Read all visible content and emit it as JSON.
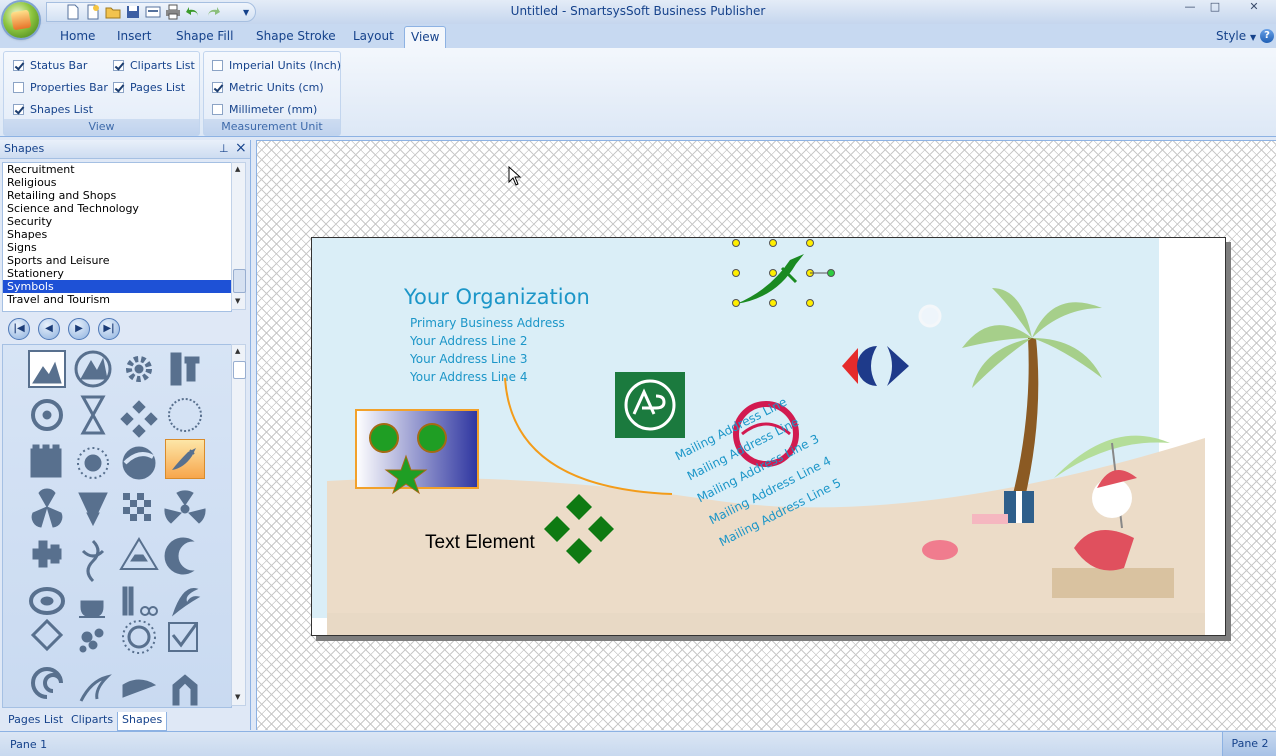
{
  "window": {
    "title": "Untitled - SmartsysSoft Business Publisher",
    "minimize_label": "—",
    "maximize_label": "□",
    "close_label": "✕"
  },
  "ribbon": {
    "tabs": [
      "Home",
      "Insert",
      "Shape Fill",
      "Shape Stroke",
      "Layout",
      "View"
    ],
    "active_tab": "View",
    "style_label": "Style",
    "help_label": "?",
    "view_group": {
      "caption": "View",
      "checks": [
        {
          "label": "Status Bar",
          "checked": true
        },
        {
          "label": "Properties Bar",
          "checked": false
        },
        {
          "label": "Shapes List",
          "checked": true
        },
        {
          "label": "Cliparts List",
          "checked": true
        },
        {
          "label": "Pages List",
          "checked": true
        }
      ]
    },
    "measure_group": {
      "caption": "Measurement Unit",
      "checks": [
        {
          "label": "Imperial Units (Inch)",
          "checked": false
        },
        {
          "label": "Metric Units (cm)",
          "checked": true
        },
        {
          "label": "Millimeter (mm)",
          "checked": false
        }
      ]
    }
  },
  "shapes_panel": {
    "title": "Shapes",
    "categories": [
      "Recruitment",
      "Religious",
      "Retailing and Shops",
      "Science and Technology",
      "Security",
      "Shapes",
      "Signs",
      "Sports and Leisure",
      "Stationery",
      "Symbols",
      "Travel and Tourism"
    ],
    "selected_category": "Symbols",
    "bottom_tabs": [
      "Pages List",
      "Cliparts",
      "Shapes"
    ],
    "active_bottom_tab": "Shapes",
    "icons": [
      "landscape-icon",
      "mountain-circle-icon",
      "gear-icon",
      "tools-icon",
      "biohazard-icon",
      "hourglass-icon",
      "diamond-cross-icon",
      "dotted-circle-icon",
      "castle-tower-icon",
      "sunburst-icon",
      "swoosh-circle-icon",
      "sword-icon",
      "propeller-icon",
      "bird-emblem-icon",
      "checker-icon",
      "radiation-icon",
      "puzzle-icon",
      "tribal-swirl-icon",
      "ship-emblem-icon",
      "crescent-icon",
      "leaf-ring-icon",
      "coffee-cup-icon",
      "comb-scissors-icon",
      "flame-icon",
      "tag-icon",
      "dots-cluster-icon",
      "sun-ring-icon",
      "checkbox-icon",
      "spiral-icon",
      "grass-icon",
      "wave-flag-icon",
      "arch-icon"
    ]
  },
  "card": {
    "org_name": "Your Organization",
    "address_lines": [
      "Primary Business Address",
      "Your Address Line 2",
      "Your Address Line 3",
      "Your Address Line 4"
    ],
    "mailing_lines": [
      "Mailing Address Line",
      "Mailing Address Line",
      "Mailing Address Line 3",
      "Mailing Address Line 4",
      "Mailing Address Line 5"
    ],
    "text_element": "Text Element"
  },
  "status": {
    "pane1": "Pane 1",
    "pane2": "Pane 2"
  },
  "colors": {
    "accent": "#15428b",
    "card_text": "#1c96c8",
    "sky": "#daeef7",
    "sand": "#ecdcc8",
    "green_shape": "#0e7a12",
    "selection": "#1e51d6"
  }
}
